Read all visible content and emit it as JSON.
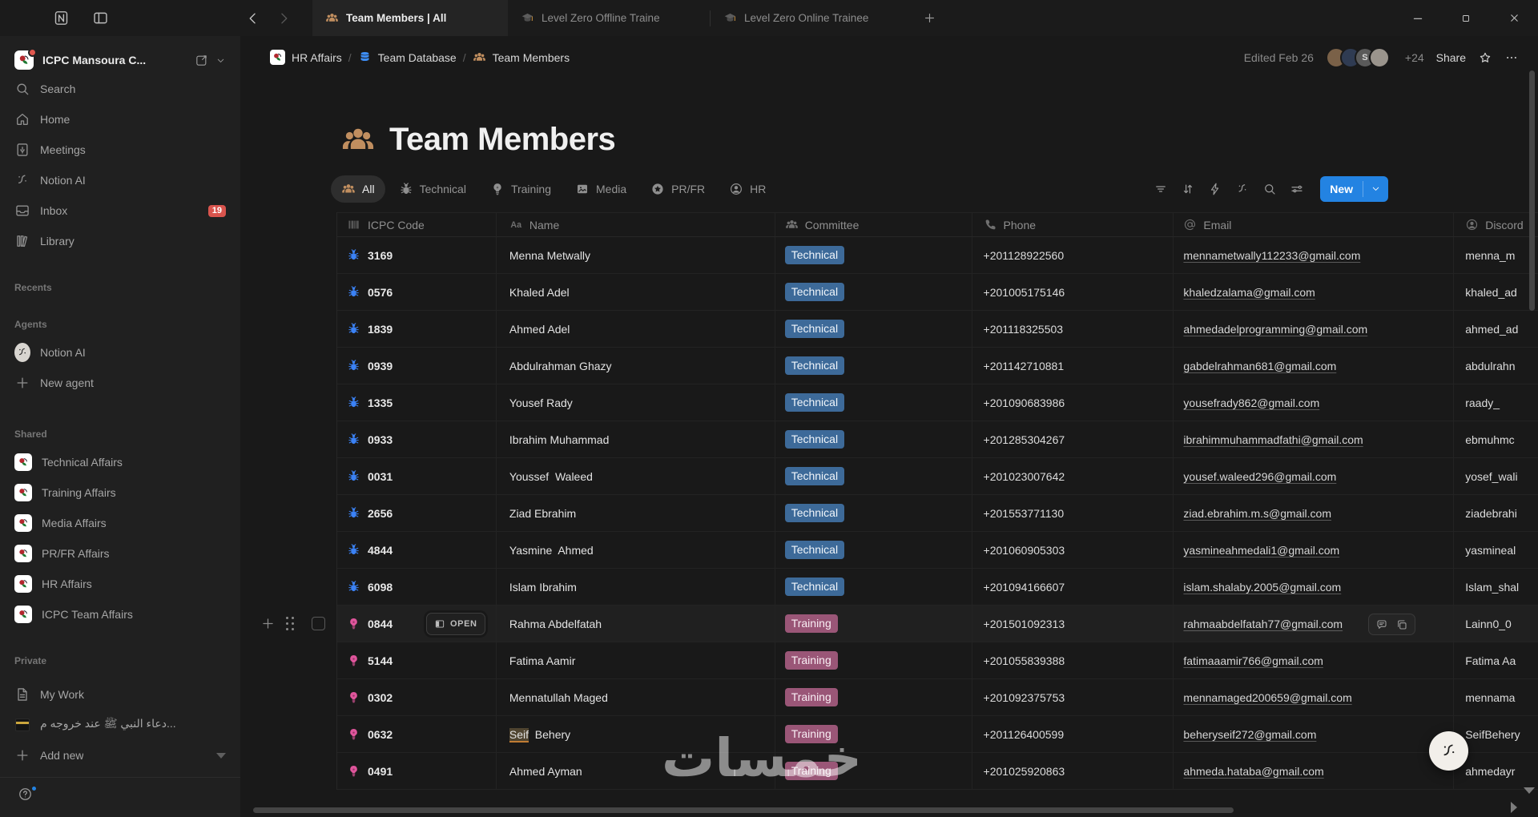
{
  "window": {
    "tabs": [
      {
        "label": "Team Members | All",
        "icon": "people-icon",
        "active": true
      },
      {
        "label": "Level Zero Offline Traine",
        "icon": "graduation-cap-icon",
        "active": false
      },
      {
        "label": "Level Zero Online Trainee",
        "icon": "graduation-cap-icon",
        "active": false
      }
    ]
  },
  "breadcrumb": {
    "items": [
      {
        "label": "HR Affairs",
        "icon": "workspace-logo-icon"
      },
      {
        "label": "Team Database",
        "icon": "database-icon"
      },
      {
        "label": "Team Members",
        "icon": "people-icon"
      }
    ],
    "separator": "/",
    "edited": "Edited Feb 26",
    "overflow_count": "+24",
    "share_label": "Share",
    "avatars": [
      {
        "initial": "",
        "color": "#7a6148"
      },
      {
        "initial": "",
        "color": "#2f3b52"
      },
      {
        "initial": "S",
        "color": "#5a5a5a"
      },
      {
        "initial": "",
        "color": "#9a948c"
      }
    ]
  },
  "sidebar": {
    "workspace_name": "ICPC Mansoura C...",
    "nav": [
      {
        "label": "Search",
        "icon": "search-icon"
      },
      {
        "label": "Home",
        "icon": "home-icon"
      },
      {
        "label": "Meetings",
        "icon": "meetings-icon"
      },
      {
        "label": "Notion AI",
        "icon": "ai-face-icon"
      },
      {
        "label": "Inbox",
        "icon": "inbox-icon",
        "badge": "19"
      },
      {
        "label": "Library",
        "icon": "library-icon"
      }
    ],
    "sections": [
      {
        "id": "recents",
        "title": "Recents",
        "items": []
      },
      {
        "id": "agents",
        "title": "Agents",
        "items": [
          {
            "label": "Notion AI",
            "icon": "ai-avatar-icon"
          },
          {
            "label": "New agent",
            "icon": "plus-icon"
          }
        ]
      },
      {
        "id": "shared",
        "title": "Shared",
        "items": [
          {
            "label": "Technical Affairs",
            "icon": "workspace-logo-icon"
          },
          {
            "label": "Training Affairs",
            "icon": "workspace-logo-icon"
          },
          {
            "label": "Media Affairs",
            "icon": "workspace-logo-icon"
          },
          {
            "label": "PR/FR Affairs",
            "icon": "workspace-logo-icon"
          },
          {
            "label": "HR Affairs",
            "icon": "workspace-logo-icon"
          },
          {
            "label": "ICPC Team Affairs",
            "icon": "workspace-logo-icon"
          }
        ]
      },
      {
        "id": "private",
        "title": "Private",
        "items": [
          {
            "label": "My Work",
            "icon": "page-icon"
          },
          {
            "label": "دعاء النبي ﷺ عند خروجه م...",
            "icon": "kaaba-icon"
          },
          {
            "label": "Add new",
            "icon": "plus-icon",
            "trailing": "triangle-down"
          }
        ]
      }
    ]
  },
  "page": {
    "title": "Team Members",
    "views": [
      {
        "label": "All",
        "icon": "people-icon",
        "active": true
      },
      {
        "label": "Technical",
        "icon": "bug-icon",
        "active": false
      },
      {
        "label": "Training",
        "icon": "bulb-icon",
        "active": false
      },
      {
        "label": "Media",
        "icon": "image-icon",
        "active": false
      },
      {
        "label": "PR/FR",
        "icon": "star-circle-icon",
        "active": false
      },
      {
        "label": "HR",
        "icon": "person-circle-icon",
        "active": false
      }
    ],
    "new_button_label": "New"
  },
  "table": {
    "columns": [
      {
        "label": "ICPC Code",
        "icon": "barcode-icon"
      },
      {
        "label": "Name",
        "icon": "aa-icon"
      },
      {
        "label": "Committee",
        "icon": "people-icon"
      },
      {
        "label": "Phone",
        "icon": "phone-icon"
      },
      {
        "label": "Email",
        "icon": "at-icon"
      },
      {
        "label": "Discord",
        "icon": "person-circle-icon"
      }
    ],
    "open_label": "OPEN",
    "tag_colors": {
      "Technical": {
        "bg": "#3d6a99",
        "fg": "#f1f6fb"
      },
      "Training": {
        "bg": "#9a5677",
        "fg": "#f9eef4"
      }
    },
    "row_icon": {
      "Technical": "bug-icon",
      "Training": "bulb-icon"
    },
    "row_icon_colors": {
      "Technical": "#3b82f6",
      "Training": "#e0559c"
    },
    "rows": [
      {
        "code": "3169",
        "name": "Menna Metwally",
        "committee": "Technical",
        "phone": "+201128922560",
        "email": "mennametwally112233@gmail.com",
        "discord": "menna_m"
      },
      {
        "code": "0576",
        "name": "Khaled Adel",
        "committee": "Technical",
        "phone": "+201005175146",
        "email": "khaledzalama@gmail.com",
        "discord": "khaled_ad"
      },
      {
        "code": "1839",
        "name": "Ahmed Adel",
        "committee": "Technical",
        "phone": "+201118325503",
        "email": "ahmedadelprogramming@gmail.com",
        "discord": "ahmed_ad"
      },
      {
        "code": "0939",
        "name": "Abdulrahman Ghazy",
        "committee": "Technical",
        "phone": "+201142710881",
        "email": "gabdelrahman681@gmail.com",
        "discord": "abdulrahn"
      },
      {
        "code": "1335",
        "name": "Yousef Rady",
        "committee": "Technical",
        "phone": "+201090683986",
        "email": "yousefrady862@gmail.com",
        "discord": "raady_"
      },
      {
        "code": "0933",
        "name": "Ibrahim Muhammad",
        "committee": "Technical",
        "phone": "+201285304267",
        "email": "ibrahimmuhammadfathi@gmail.com",
        "discord": "ebmuhmc"
      },
      {
        "code": "0031",
        "name": "Youssef  Waleed",
        "committee": "Technical",
        "phone": "+201023007642",
        "email": "yousef.waleed296@gmail.com",
        "discord": "yosef_wali"
      },
      {
        "code": "2656",
        "name": "Ziad Ebrahim",
        "committee": "Technical",
        "phone": "+201553771130",
        "email": "ziad.ebrahim.m.s@gmail.com",
        "discord": "ziadebrahi"
      },
      {
        "code": "4844",
        "name": "Yasmine  Ahmed",
        "committee": "Technical",
        "phone": "+201060905303",
        "email": "yasmineahmedali1@gmail.com",
        "discord": "yasmineal"
      },
      {
        "code": "6098",
        "name": "Islam Ibrahim",
        "committee": "Technical",
        "phone": "+201094166607",
        "email": "islam.shalaby.2005@gmail.com",
        "discord": "Islam_shal"
      },
      {
        "code": "0844",
        "name": "Rahma Abdelfatah",
        "committee": "Training",
        "phone": "+201501092313",
        "email": "rahmaabdelfatah77@gmail.com",
        "discord": "Lainn0_0",
        "hover": true
      },
      {
        "code": "5144",
        "name": "Fatima Aamir",
        "committee": "Training",
        "phone": "+201055839388",
        "email": "fatimaaamir766@gmail.com",
        "discord": "Fatima Aa"
      },
      {
        "code": "0302",
        "name": "Mennatullah Maged",
        "committee": "Training",
        "phone": "+201092375753",
        "email": "mennamaged200659@gmail.com",
        "discord": "mennama"
      },
      {
        "code": "0632",
        "name": "Seif  Behery",
        "committee": "Training",
        "phone": "+201126400599",
        "email": "beheryseif272@gmail.com",
        "discord": "SeifBehery",
        "highlight": "Seif"
      },
      {
        "code": "0491",
        "name": "Ahmed Ayman",
        "committee": "Training",
        "phone": "+201025920863",
        "email": "ahmeda.hataba@gmail.com",
        "discord": "ahmedayr"
      }
    ]
  },
  "watermark": "خمسات",
  "accent_color": "#2383e2"
}
